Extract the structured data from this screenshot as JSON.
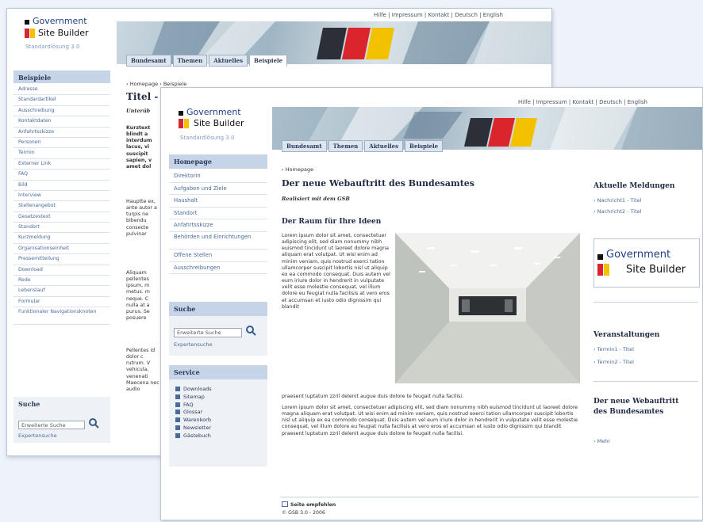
{
  "logo": {
    "line1": "Government",
    "line2": "Site Builder",
    "version": "Standardlösung 3.0"
  },
  "top_nav": [
    "Hilfe",
    "Impressum",
    "Kontakt",
    "Deutsch",
    "English"
  ],
  "back_tabs": [
    "Bundesamt",
    "Themen",
    "Aktuelles",
    "Beispiele"
  ],
  "front_tabs": [
    "Bundesamt",
    "Themen",
    "Aktuelles",
    "Beispiele"
  ],
  "back_window": {
    "sidebar_title": "Beispiele",
    "sidebar_items": [
      "Adresse",
      "Standardartikel",
      "Ausschreibung",
      "Kontaktdaten",
      "Anfahrtsskizze",
      "Personen",
      "Termin",
      "Externer Link",
      "FAQ",
      "Bild",
      "Interview",
      "Stellenangebot",
      "Gesetzestext",
      "Standort",
      "Kurzmeldung",
      "Organisationseinheit",
      "Pressemitteilung",
      "Download",
      "Rede",
      "Lebenslauf",
      "Formular",
      "Funktionaler Navigationsknoten"
    ],
    "breadcrumb": "› Homepage  › Beispiele",
    "title": "Titel -",
    "subtitle": "Unterüb",
    "text_bold": "Kurztext blindt a interdum lacus, vi suscipit sapien, v amet dol",
    "text1": "Hauptte ex, ante autor a turpis ne bibendu consecte pulvinar",
    "text2": "Aliquam pellentes ipsum, m metus. m neque. C nulla at a purus. Se posuere",
    "text3": "Pellentes id dolor c rutrum. V vehicula, venenati Maecena nec audio",
    "search": {
      "title": "Suche",
      "placeholder": "Erweiterte Suche",
      "expert": "Expertensuche"
    }
  },
  "front_window": {
    "sidebar_title": "Homepage",
    "sidebar_items": [
      "Direktorin",
      "Aufgaben und Ziele",
      "Haushalt",
      "Standort",
      "Anfahrtsskizze",
      "Behörden und Einrichtungen",
      "Offene Stellen",
      "Ausschreibungen"
    ],
    "search": {
      "title": "Suche",
      "placeholder": "Erweiterte Suche",
      "expert": "Expertensuche"
    },
    "service": {
      "title": "Service",
      "items": [
        "Downloads",
        "Sitemap",
        "FAQ",
        "Glossar",
        "Warenkorb",
        "Newsletter",
        "Gästebuch"
      ]
    },
    "breadcrumb": "› Homepage",
    "title": "Der neue Webauftritt des Bundesamtes",
    "subtitle": "Realisiert mit dem GSB",
    "section_title": "Der Raum für Ihre Ideen",
    "para1": "Lorem ipsum dolor sit amet, consectetuer adipiscing elit, sed diam nonummy nibh euismod tincidunt ut laoreet dolore magna aliquam erat volutpat. Ut wisi enim ad minim veniam, quis nostrud exerci tation ullamcorper suscipit lobortis nisl ut aliquip ex ea commodo consequat. Duis autem vel eum iriure dolor in hendrerit in vulputate velit esse molestie consequat, vel illum dolore eu feugiat nulla facilisis at vero eros et accumsan et iusto odio dignissim qui blandit",
    "para1_end": "praesent luptatum zzril delenit augue duis dolore te feugait nulla facilisi.",
    "para2": "Lorem ipsum dolor sit amet, consectetuer adipiscing elit, sed diam nonummy nibh euismod tincidunt ut laoreet dolore magna aliquam erat volutpat. Ut wisi enim ad minim veniam, quis nostrud exerci tation ullamcorper suscipit lobortis nisl ut aliquip ex ea commodo consequat. Duis autem vel eum iriure dolor in hendrerit in vulputate velit esse molestie consequat, vel illum dolore eu feugiat nulla facilisis at vero eros et accumsan et iusto odio dignissim qui blandit praesent luptatum zzril delenit augue duis dolore te feugait nulla facilisi.",
    "right": {
      "news_title": "Aktuelle Meldungen",
      "news_items": [
        "› Nachricht1 - Titel",
        "› Nachricht2 - Titel"
      ],
      "events_title": "Veranstaltungen",
      "event_items": [
        "› Termin1 - Titel",
        "› Termin2 - Titel"
      ],
      "promo_title": "Der neue Webauftritt des Bundesamtes",
      "promo_link": "› Mehr"
    },
    "footer": {
      "print": "Seite empfehlen",
      "copyright": "© GSB 3.0 - 2006"
    }
  }
}
